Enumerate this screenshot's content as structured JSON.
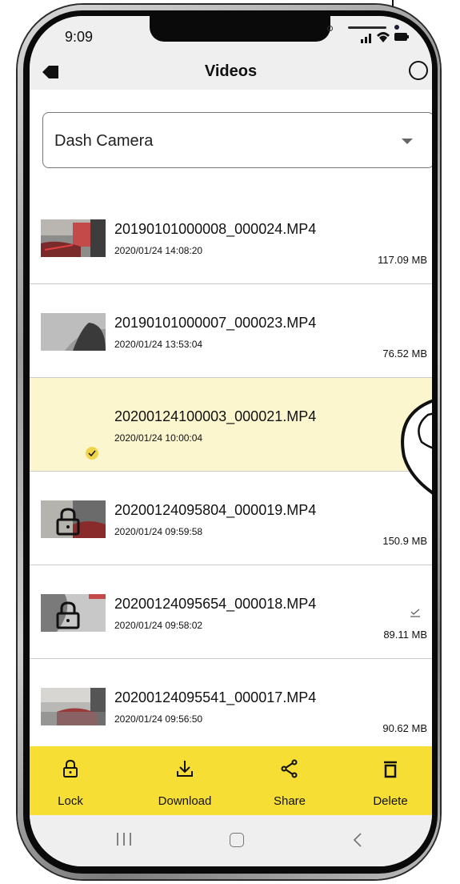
{
  "status_bar": {
    "time": "9:09"
  },
  "header": {
    "title": "Videos",
    "back_icon": "back-arrow-icon",
    "select_icon": "circle-select-icon"
  },
  "dropdown": {
    "selected": "Dash Camera"
  },
  "videos": [
    {
      "name": "20190101000008_000024.MP4",
      "date": "2020/01/24 14:08:20",
      "size": "117.09 MB",
      "locked": false,
      "selected": false,
      "downloaded": false
    },
    {
      "name": "20190101000007_000023.MP4",
      "date": "2020/01/24 13:53:04",
      "size": "76.52 MB",
      "locked": false,
      "selected": false,
      "downloaded": false
    },
    {
      "name": "20200124100003_000021.MP4",
      "date": "2020/01/24 10:00:04",
      "size": "",
      "locked": false,
      "selected": true,
      "downloaded": false
    },
    {
      "name": "20200124095804_000019.MP4",
      "date": "2020/01/24 09:59:58",
      "size": "150.9 MB",
      "locked": true,
      "selected": false,
      "downloaded": false
    },
    {
      "name": "20200124095654_000018.MP4",
      "date": "2020/01/24 09:58:02",
      "size": "89.11 MB",
      "locked": true,
      "selected": false,
      "downloaded": true
    },
    {
      "name": "20200124095541_000017.MP4",
      "date": "2020/01/24 09:56:50",
      "size": "90.62 MB",
      "locked": false,
      "selected": false,
      "downloaded": false
    }
  ],
  "actions": [
    {
      "label": "Lock",
      "icon": "lock-icon"
    },
    {
      "label": "Download",
      "icon": "download-icon"
    },
    {
      "label": "Share",
      "icon": "share-icon"
    },
    {
      "label": "Delete",
      "icon": "trash-icon"
    }
  ],
  "colors": {
    "accent": "#f6de35",
    "selected_row": "#fcf6cf",
    "check": "#f0d44a"
  }
}
